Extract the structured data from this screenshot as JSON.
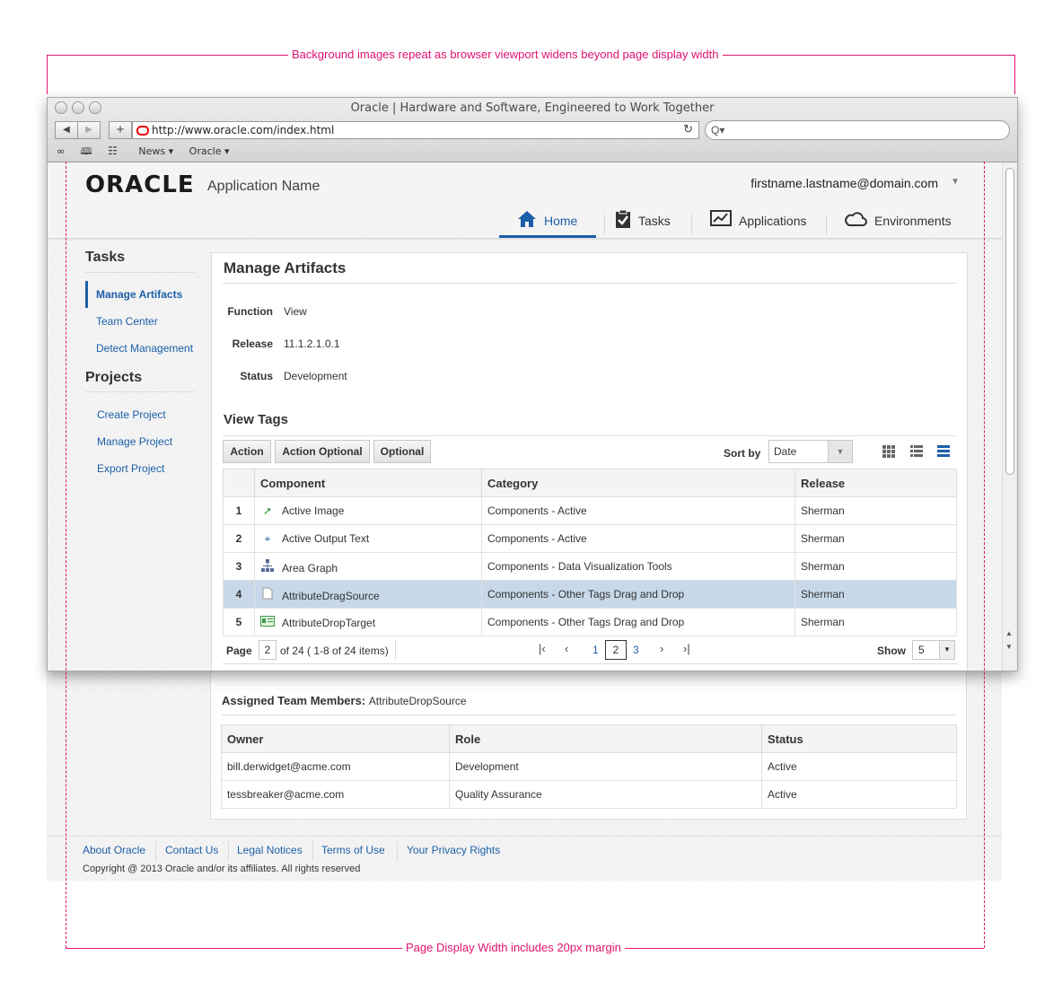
{
  "annotations": {
    "top": "Background images repeat as browser viewport widens beyond page display width",
    "bottom": "Page Display Width includes 20px margin"
  },
  "browser": {
    "title": "Oracle | Hardware and Software, Engineered to Work Together",
    "url": "http://www.oracle.com/index.html",
    "back_glyph": "◀",
    "forward_glyph": "▶",
    "add_glyph": "+",
    "reload_glyph": "↻",
    "search_glyph": "Q▾",
    "bookmarks": [
      "News ▾",
      "Oracle ▾"
    ],
    "bookmark_icons": [
      "reading-list-icon",
      "bookmarks-book-icon",
      "top-sites-grid-icon"
    ]
  },
  "header": {
    "logo": "ORACLE",
    "app_name": "Application Name",
    "user": "firstname.lastname@domain.com",
    "user_caret": "▼",
    "nav": [
      {
        "label": "Home",
        "icon": "home-icon"
      },
      {
        "label": "Tasks",
        "icon": "clipboard-check-icon"
      },
      {
        "label": "Applications",
        "icon": "chart-icon"
      },
      {
        "label": "Environments",
        "icon": "cloud-icon"
      }
    ]
  },
  "sidebar": {
    "tasks_heading": "Tasks",
    "tasks": [
      "Manage Artifacts",
      "Team Center",
      "Detect Management"
    ],
    "projects_heading": "Projects",
    "projects": [
      "Create Project",
      "Manage Project",
      "Export Project"
    ]
  },
  "main": {
    "title": "Manage Artifacts",
    "fields": [
      {
        "label": "Function",
        "value": "View"
      },
      {
        "label": "Release",
        "value": "11.1.2.1.0.1"
      },
      {
        "label": "Status",
        "value": "Development"
      }
    ],
    "tags_heading": "View Tags",
    "toolbar": {
      "buttons": [
        "Action",
        "Action Optional",
        "Optional"
      ],
      "sort_label": "Sort by",
      "sort_value": "Date",
      "sort_dropdown_glyph": "▼"
    },
    "table": {
      "columns": [
        "Component",
        "Category",
        "Release"
      ],
      "rows": [
        {
          "num": "1",
          "icon": "export-arrow-icon",
          "component": "Active Image",
          "category": "Components - Active",
          "release": "Sherman"
        },
        {
          "num": "2",
          "icon": "pin-icon",
          "component": "Active Output Text",
          "category": "Components - Active",
          "release": "Sherman"
        },
        {
          "num": "3",
          "icon": "hierarchy-icon",
          "component": "Area Graph",
          "category": "Components - Data Visualization Tools",
          "release": "Sherman"
        },
        {
          "num": "4",
          "icon": "document-icon",
          "component": "AttributeDragSource",
          "category": "Components - Other Tags Drag and Drop",
          "release": "Sherman"
        },
        {
          "num": "5",
          "icon": "card-icon",
          "component": "AttributeDropTarget",
          "category": "Components - Other Tags Drag and Drop",
          "release": "Sherman"
        }
      ]
    },
    "pager": {
      "page_label": "Page",
      "page_value": "2",
      "of_text": "of 24 ( 1-8 of 24 items)",
      "first_glyph": "|‹",
      "prev_glyph": "‹",
      "next_glyph": "›",
      "last_glyph": "›|",
      "pages": [
        "1",
        "2",
        "3"
      ],
      "show_label": "Show",
      "show_value": "5",
      "show_dropdown_glyph": "▼"
    },
    "team": {
      "heading": "Assigned Team Members:",
      "subject": "AttributeDropSource",
      "columns": [
        "Owner",
        "Role",
        "Status"
      ],
      "rows": [
        {
          "owner": "bill.derwidget@acme.com",
          "role": "Development",
          "status": "Active"
        },
        {
          "owner": "tessbreaker@acme.com",
          "role": "Quality Assurance",
          "status": "Active"
        }
      ]
    }
  },
  "footer": {
    "links": [
      "About Oracle",
      "Contact Us",
      "Legal Notices",
      "Terms of Use",
      "Your Privacy Rights"
    ],
    "copyright": "Copyright @ 2013 Oracle and/or its affiliates. All rights reserved"
  },
  "colors": {
    "accent": "#1c5fa8",
    "annotation": "#e0126f",
    "selected_row": "#c7d8e8"
  }
}
